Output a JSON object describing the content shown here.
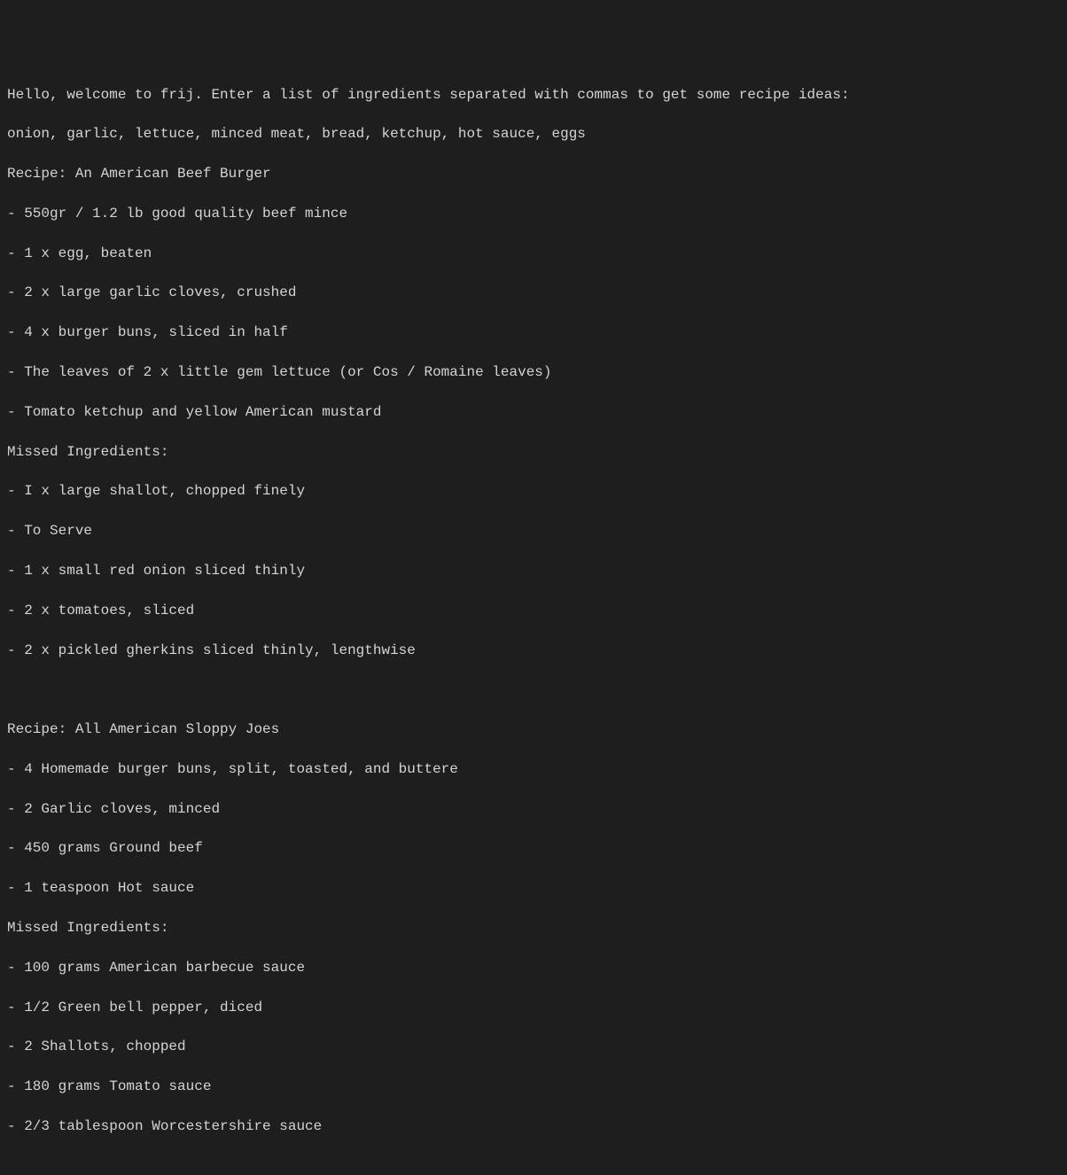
{
  "terminal": {
    "welcome": "Hello, welcome to frij. Enter a list of ingredients separated with commas to get some recipe ideas:",
    "input": "onion, garlic, lettuce, minced meat, bread, ketchup, hot sauce, eggs",
    "recipes": [
      {
        "title": "Recipe: An American Beef Burger",
        "ingredients": [
          "- 550gr / 1.2 lb good quality beef mince",
          "- 1 x egg, beaten",
          "- 2 x large garlic cloves, crushed",
          "- 4 x burger buns, sliced in half",
          "- The leaves of 2 x little gem lettuce (or Cos / Romaine leaves)",
          "- Tomato ketchup and yellow American mustard"
        ],
        "missed_header": "Missed Ingredients:",
        "missed": [
          "- I x large shallot, chopped finely",
          "- To Serve",
          "- 1 x small red onion sliced thinly",
          "- 2 x tomatoes, sliced",
          "- 2 x pickled gherkins sliced thinly, lengthwise"
        ]
      },
      {
        "title": "Recipe: All American Sloppy Joes",
        "ingredients": [
          "- 4 Homemade burger buns, split, toasted, and buttere",
          "- 2 Garlic cloves, minced",
          "- 450 grams Ground beef",
          "- 1 teaspoon Hot sauce"
        ],
        "missed_header": "Missed Ingredients:",
        "missed": [
          "- 100 grams American barbecue sauce",
          "- 1/2 Green bell pepper, diced",
          "- 2 Shallots, chopped",
          "- 180 grams Tomato sauce",
          "- 2/3 tablespoon Worcestershire sauce"
        ]
      }
    ]
  }
}
